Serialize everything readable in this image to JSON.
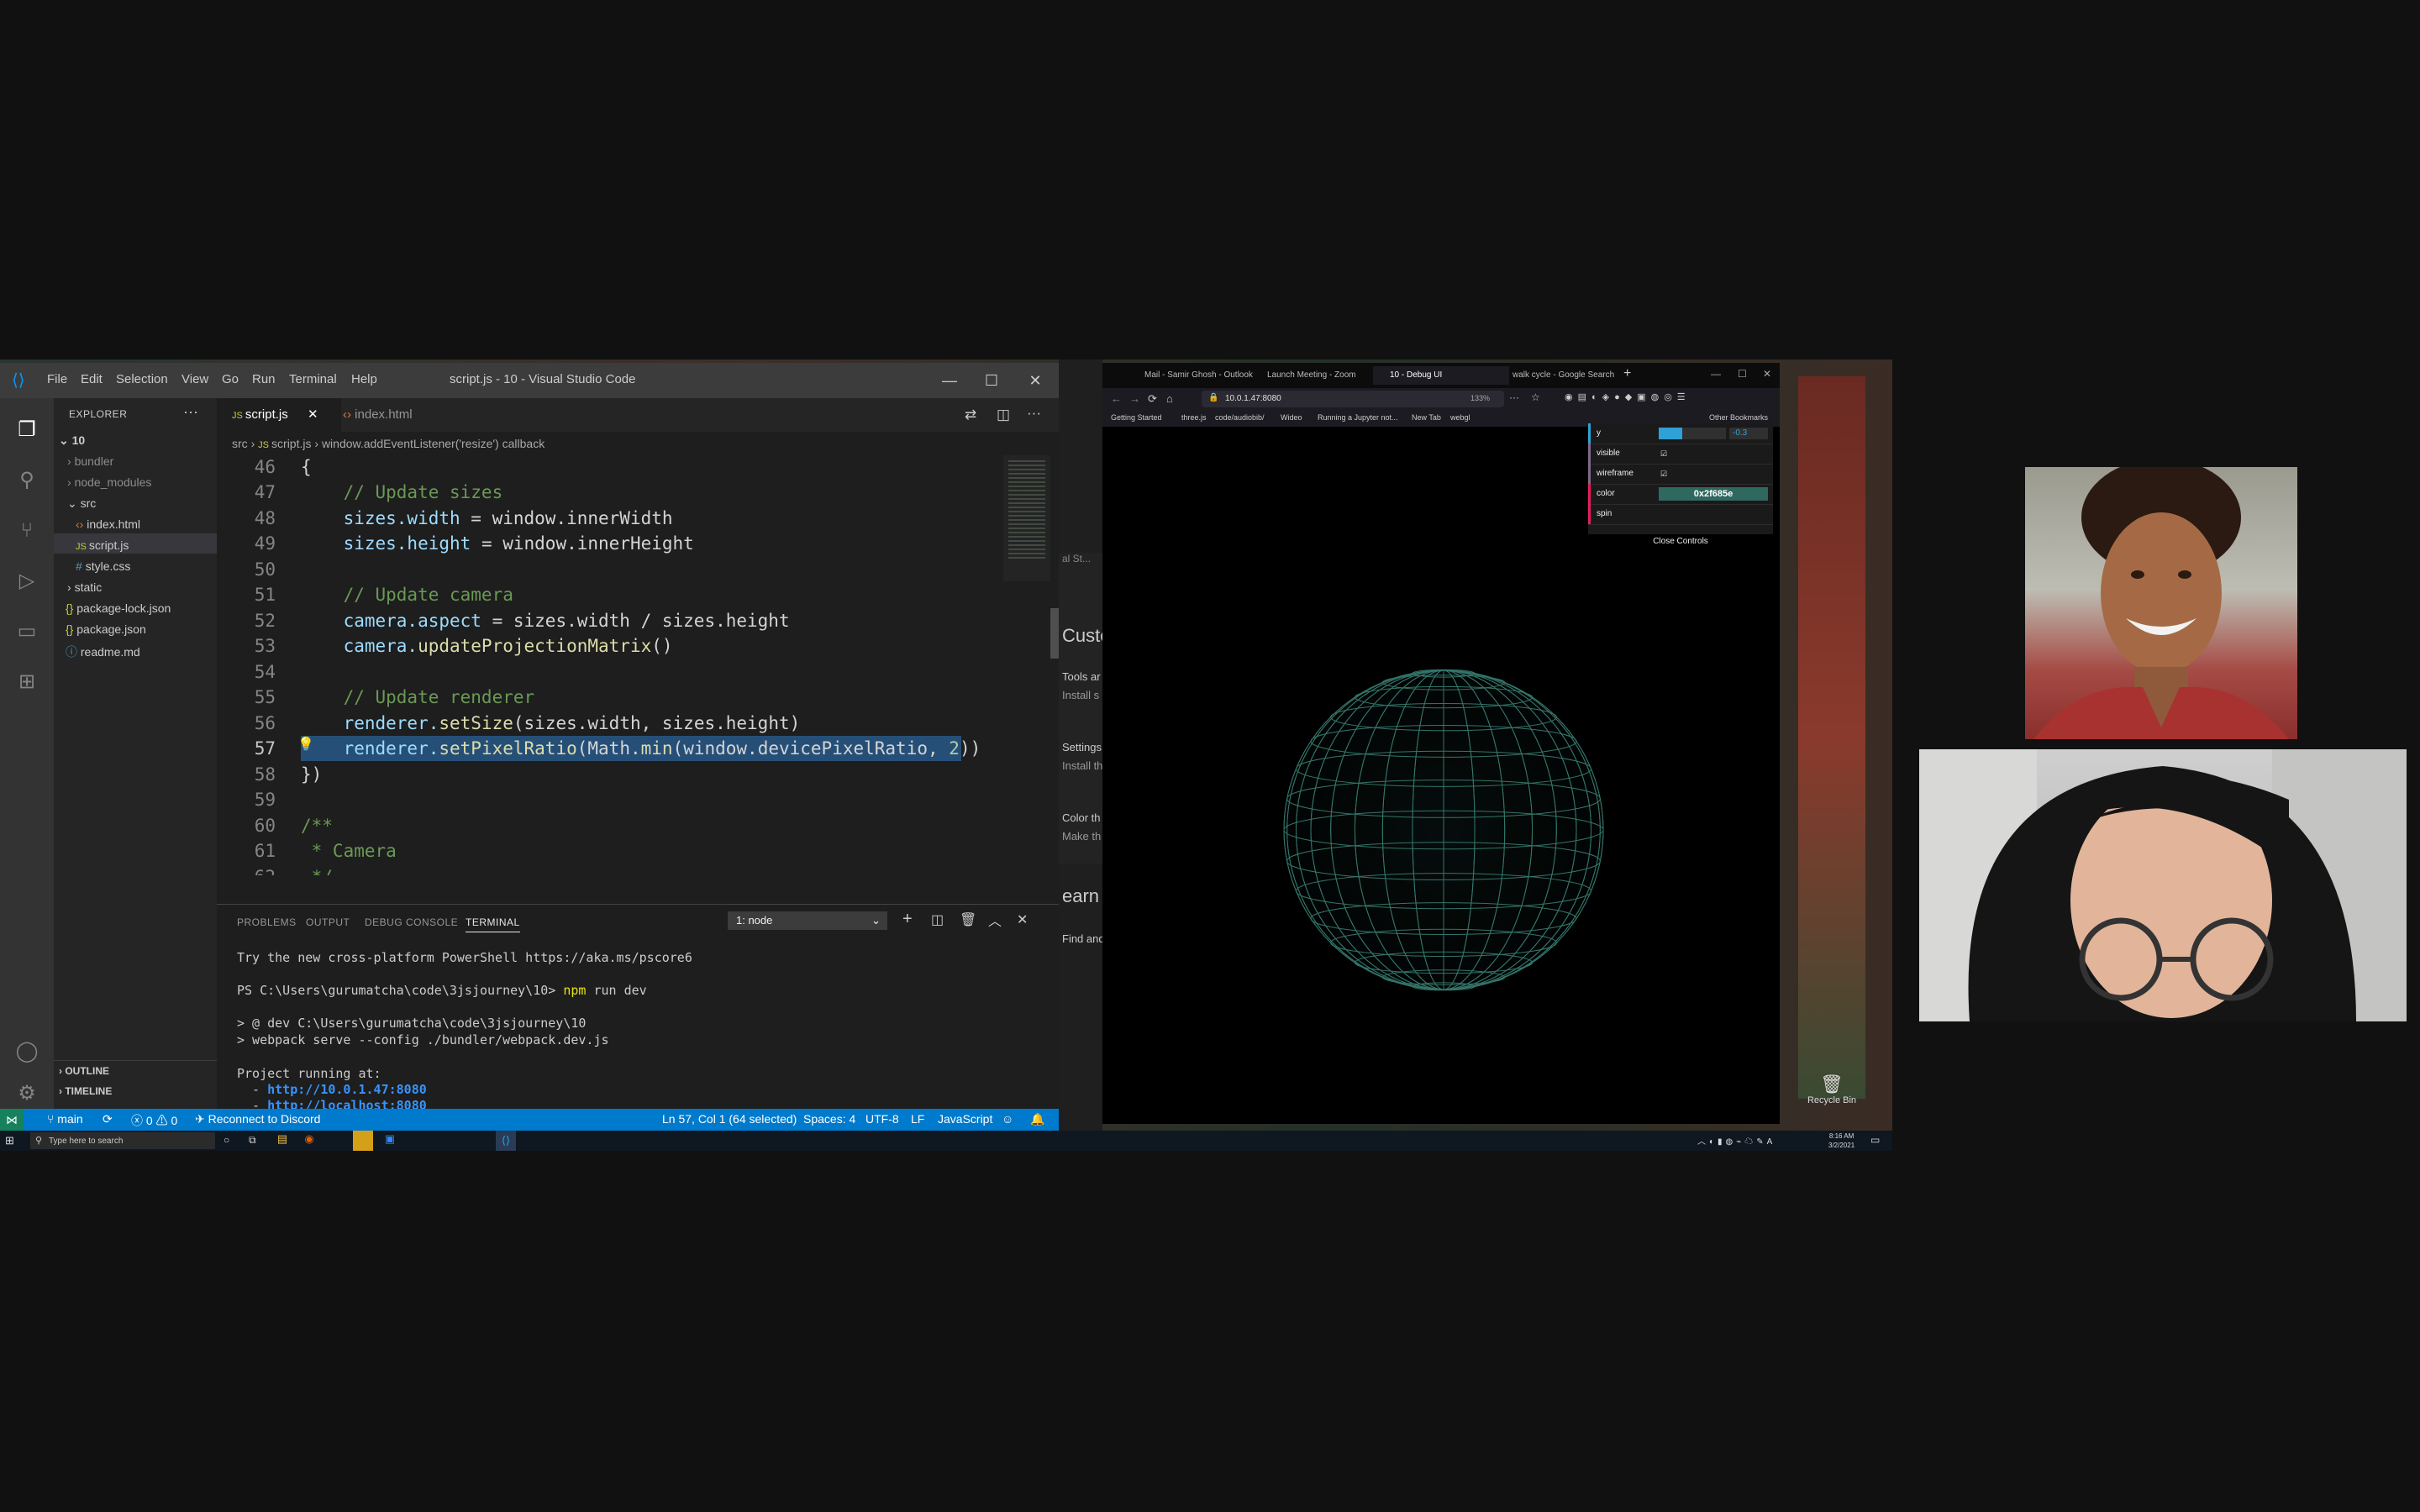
{
  "vscode": {
    "menu": [
      "File",
      "Edit",
      "Selection",
      "View",
      "Go",
      "Run",
      "Terminal",
      "Help"
    ],
    "title": "script.js - 10 - Visual Studio Code",
    "explorer_title": "EXPLORER",
    "root": "10",
    "tree": [
      "bundler",
      "node_modules",
      "src",
      "index.html",
      "script.js",
      "style.css",
      "static",
      "package-lock.json",
      "package.json",
      "readme.md"
    ],
    "outline": "OUTLINE",
    "timeline": "TIMELINE",
    "tabs": [
      "script.js",
      "index.html"
    ],
    "breadcrumb": {
      "a": "src",
      "b": "script.js",
      "c": "window.addEventListener('resize') callback"
    },
    "code": {
      "lines": [
        "46",
        "47",
        "48",
        "49",
        "50",
        "51",
        "52",
        "53",
        "54",
        "55",
        "56",
        "57",
        "58",
        "59",
        "60",
        "61",
        "62"
      ],
      "l46": "{",
      "l47": "    // Update sizes",
      "l48a": "    sizes.width",
      "l48b": " = window.innerWidth",
      "l49a": "    sizes.height",
      "l49b": " = window.innerHeight",
      "l51": "    // Update camera",
      "l52a": "    camera.aspect",
      "l52b": " = sizes.width / sizes.height",
      "l53a": "    camera.",
      "l53b": "updateProjectionMatrix",
      "l53c": "()",
      "l55": "    // Update renderer",
      "l56a": "    renderer.",
      "l56b": "setSize",
      "l56c": "(sizes.width, sizes.height)",
      "l57a": "    renderer.",
      "l57b": "setPixelRatio",
      "l57c": "(Math.",
      "l57d": "min",
      "l57e": "(window.devicePixelRatio, ",
      "l57f": "2",
      "l57g": "))",
      "l58": "})",
      "l60": "/**",
      "l61": " * Camera",
      "l62": " */"
    },
    "panel_tabs": [
      "PROBLEMS",
      "OUTPUT",
      "DEBUG CONSOLE",
      "TERMINAL"
    ],
    "terminal_select": "1: node",
    "terminal": {
      "t1": "Try the new cross-platform PowerShell https://aka.ms/pscore6",
      "t2a": "PS C:\\Users\\gurumatcha\\code\\3jsjourney\\10> ",
      "t2b": "npm",
      "t2c": " run dev",
      "t3": "> @ dev C:\\Users\\gurumatcha\\code\\3jsjourney\\10",
      "t4": "> webpack serve --config ./bundler/webpack.dev.js",
      "t5": "Project running at:",
      "t6a": "  - ",
      "t6b": "http://10.0.1.47:8080",
      "t7a": "  - ",
      "t7b": "http://localhost:8080"
    },
    "status": {
      "branch": "main",
      "errors": "0",
      "warnings": "0",
      "discord": "Reconnect to Discord",
      "position": "Ln 57, Col 1 (64 selected)",
      "spaces": "Spaces: 4",
      "encoding": "UTF-8",
      "eol": "LF",
      "lang": "JavaScript"
    }
  },
  "settings_peek": [
    "al St...",
    "Custom",
    "Tools ar",
    "Install s",
    "Settings",
    "Install th",
    "Color th",
    "Make th",
    "earn",
    "Find and"
  ],
  "browser": {
    "tabs": [
      "Mail - Samir Ghosh - Outlook",
      "Launch Meeting - Zoom",
      "10 - Debug UI",
      "walk cycle - Google Search"
    ],
    "url": "10.0.1.47:8080",
    "zoom": "133%",
    "bookmarks": [
      "Getting Started",
      "three.js",
      "code/audiobib/",
      "Wideo",
      "Running a Jupyter not...",
      "New Tab",
      "webgl"
    ],
    "other_bookmarks": "Other Bookmarks",
    "gui": {
      "y_label": "y",
      "y_value": "-0.3",
      "y_fraction": 0.35,
      "visible": "visible",
      "wireframe": "wireframe",
      "color_label": "color",
      "color_value": "0x2f685e",
      "spin": "spin",
      "close": "Close Controls"
    },
    "sphere_color": "#2f685e"
  },
  "taskbar": {
    "search": "Type here to search",
    "time": "8:16 AM",
    "date": "3/2/2021"
  },
  "desktop": {
    "recycle_bin": "Recycle Bin"
  },
  "colors": {
    "vscode_accent": "#007acc",
    "selection": "#264f78",
    "gui_color": "#2f685e"
  }
}
